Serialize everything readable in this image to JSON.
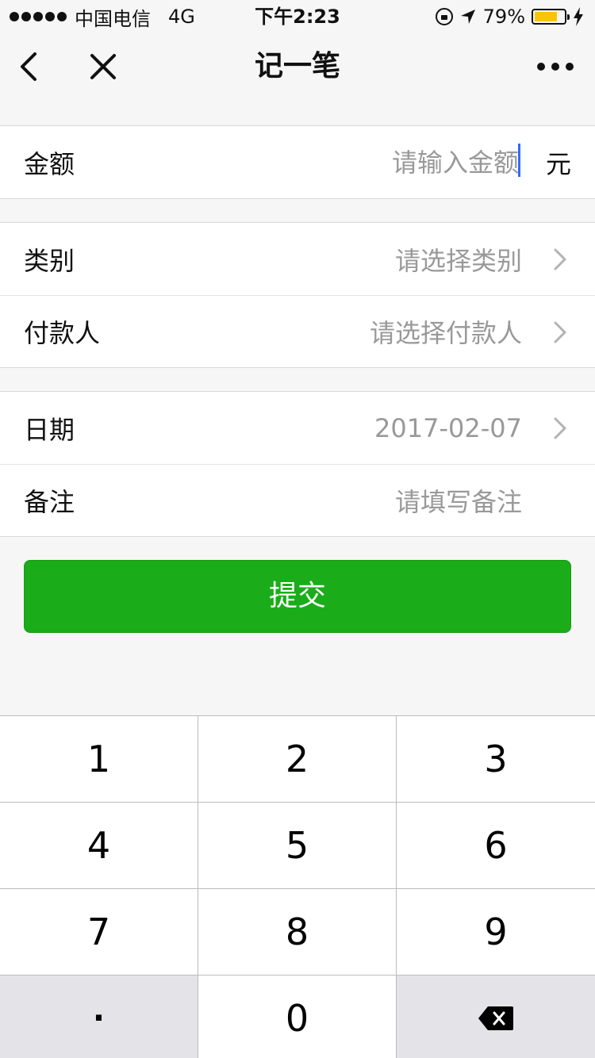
{
  "status_bar": {
    "carrier": "中国电信",
    "network": "4G",
    "time": "下午2:23",
    "battery": "79%",
    "battery_level": 0.79
  },
  "nav": {
    "title": "记一笔"
  },
  "form": {
    "amount": {
      "label": "金额",
      "placeholder": "请输入金额",
      "unit": "元"
    },
    "category": {
      "label": "类别",
      "value": "请选择类别"
    },
    "payer": {
      "label": "付款人",
      "value": "请选择付款人"
    },
    "date": {
      "label": "日期",
      "value": "2017-02-07"
    },
    "note": {
      "label": "备注",
      "value": "请填写备注"
    }
  },
  "submit_label": "提交",
  "keypad": {
    "keys": [
      "1",
      "2",
      "3",
      "4",
      "5",
      "6",
      "7",
      "8",
      "9",
      "·",
      "0"
    ]
  },
  "colors": {
    "primary_green": "#1aad19",
    "battery_yellow": "#f7c600",
    "caret_blue": "#2f6bff"
  }
}
